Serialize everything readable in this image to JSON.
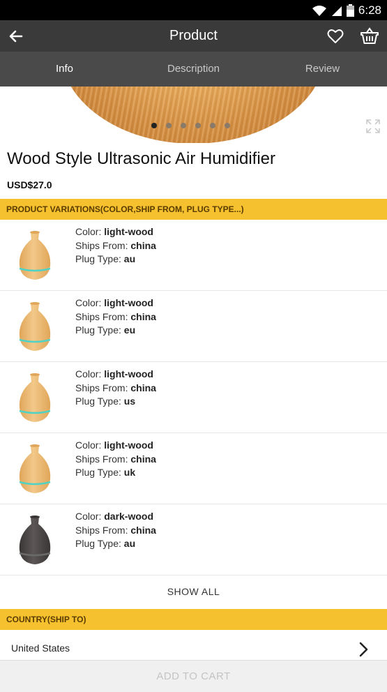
{
  "status": {
    "time": "6:28"
  },
  "app_bar": {
    "title": "Product"
  },
  "tabs": [
    {
      "label": "Info",
      "active": true
    },
    {
      "label": "Description",
      "active": false
    },
    {
      "label": "Review",
      "active": false
    }
  ],
  "gallery": {
    "dot_count": 6,
    "active_dot": 1
  },
  "product": {
    "title": "Wood Style Ultrasonic Air Humidifier",
    "price": "USD$27.0"
  },
  "variations_section": {
    "header": "PRODUCT VARIATIONS(COLOR,SHIP FROM, PLUG TYPE...)",
    "items": [
      {
        "color_label": "Color: ",
        "color": "light-wood",
        "ships_label": "Ships From: ",
        "ships": "china",
        "plug_label": "Plug Type: ",
        "plug": "au",
        "tone": "light"
      },
      {
        "color_label": "Color: ",
        "color": "light-wood",
        "ships_label": "Ships From: ",
        "ships": "china",
        "plug_label": "Plug Type: ",
        "plug": "eu",
        "tone": "light"
      },
      {
        "color_label": "Color: ",
        "color": "light-wood",
        "ships_label": "Ships From: ",
        "ships": "china",
        "plug_label": "Plug Type: ",
        "plug": "us",
        "tone": "light"
      },
      {
        "color_label": "Color: ",
        "color": "light-wood",
        "ships_label": "Ships From: ",
        "ships": "china",
        "plug_label": "Plug Type: ",
        "plug": "uk",
        "tone": "light"
      },
      {
        "color_label": "Color: ",
        "color": "dark-wood",
        "ships_label": "Ships From: ",
        "ships": "china",
        "plug_label": "Plug Type: ",
        "plug": "au",
        "tone": "dark"
      }
    ],
    "show_all": "SHOW ALL"
  },
  "country_section": {
    "header": "COUNTRY(SHIP TO)",
    "selected": "United States"
  },
  "add_to_cart": "ADD TO CART",
  "colors": {
    "accent": "#f6c12f",
    "app_bar": "#3a3a3a",
    "tab_bar": "#4a4a4a"
  },
  "icons": [
    "back-arrow-icon",
    "heart-icon",
    "basket-icon",
    "fullscreen-icon",
    "chevron-right-icon",
    "wifi-icon",
    "signal-icon",
    "battery-icon"
  ]
}
